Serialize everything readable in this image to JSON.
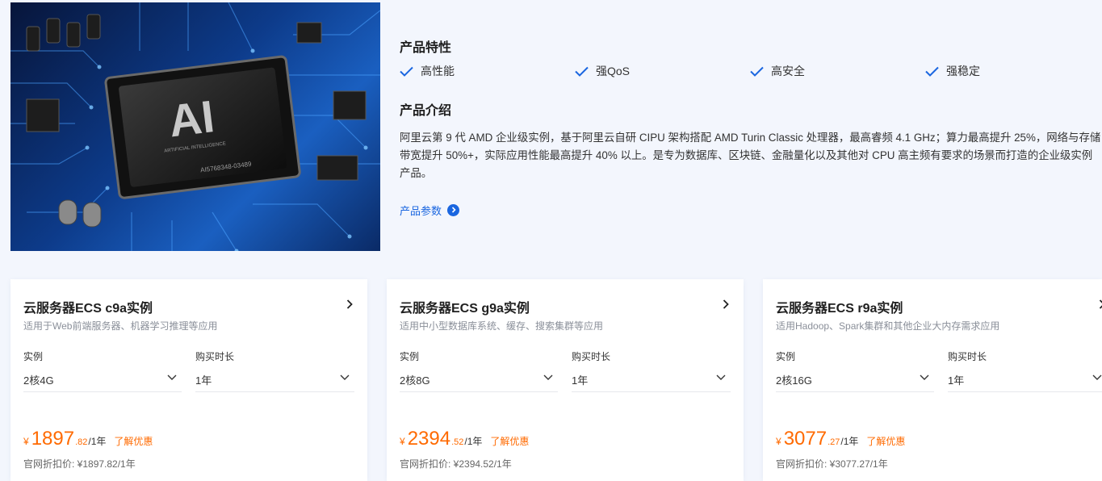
{
  "hero": {
    "image": "ai-chip-circuit-board-image",
    "chip_label": "AI",
    "chip_caption": "ARTIFICIAL INTELLIGENCE",
    "chip_code": "AI5768348-03489"
  },
  "features": {
    "title": "产品特性",
    "items": [
      {
        "label": "高性能",
        "icon": "check-icon"
      },
      {
        "label": "强QoS",
        "icon": "check-icon"
      },
      {
        "label": "高安全",
        "icon": "check-icon"
      },
      {
        "label": "强稳定",
        "icon": "check-icon"
      }
    ]
  },
  "intro": {
    "title": "产品介绍",
    "text": "阿里云第 9 代 AMD 企业级实例，基于阿里云自研 CIPU 架构搭配 AMD Turin Classic 处理器，最高睿频 4.1 GHz；算力最高提升 25%，网络与存储带宽提升 50%+，实际应用性能最高提升 40% 以上。是专为数据库、区块链、金融量化以及其他对 CPU 高主频有要求的场景而打造的企业级实例产品。",
    "link_label": "产品参数"
  },
  "colors": {
    "accent": "#1a66e0",
    "price": "#ff6a00",
    "background": "#f3f6fd"
  },
  "cards": [
    {
      "title": "云服务器ECS c9a实例",
      "subtitle": "适用于Web前端服务器、机器学习推理等应用",
      "instance_label": "实例",
      "instance_value": "2核4G",
      "duration_label": "购买时长",
      "duration_value": "1年",
      "currency": "¥",
      "price_int": "1897",
      "price_dec": ".82",
      "price_unit": "/1年",
      "promo": "了解优惠",
      "official_price": "官网折扣价: ¥1897.82/1年"
    },
    {
      "title": "云服务器ECS g9a实例",
      "subtitle": "适用中小型数据库系统、缓存、搜索集群等应用",
      "instance_label": "实例",
      "instance_value": "2核8G",
      "duration_label": "购买时长",
      "duration_value": "1年",
      "currency": "¥",
      "price_int": "2394",
      "price_dec": ".52",
      "price_unit": "/1年",
      "promo": "了解优惠",
      "official_price": "官网折扣价: ¥2394.52/1年"
    },
    {
      "title": "云服务器ECS r9a实例",
      "subtitle": "适用Hadoop、Spark集群和其他企业大内存需求应用",
      "instance_label": "实例",
      "instance_value": "2核16G",
      "duration_label": "购买时长",
      "duration_value": "1年",
      "currency": "¥",
      "price_int": "3077",
      "price_dec": ".27",
      "price_unit": "/1年",
      "promo": "了解优惠",
      "official_price": "官网折扣价: ¥3077.27/1年"
    }
  ]
}
